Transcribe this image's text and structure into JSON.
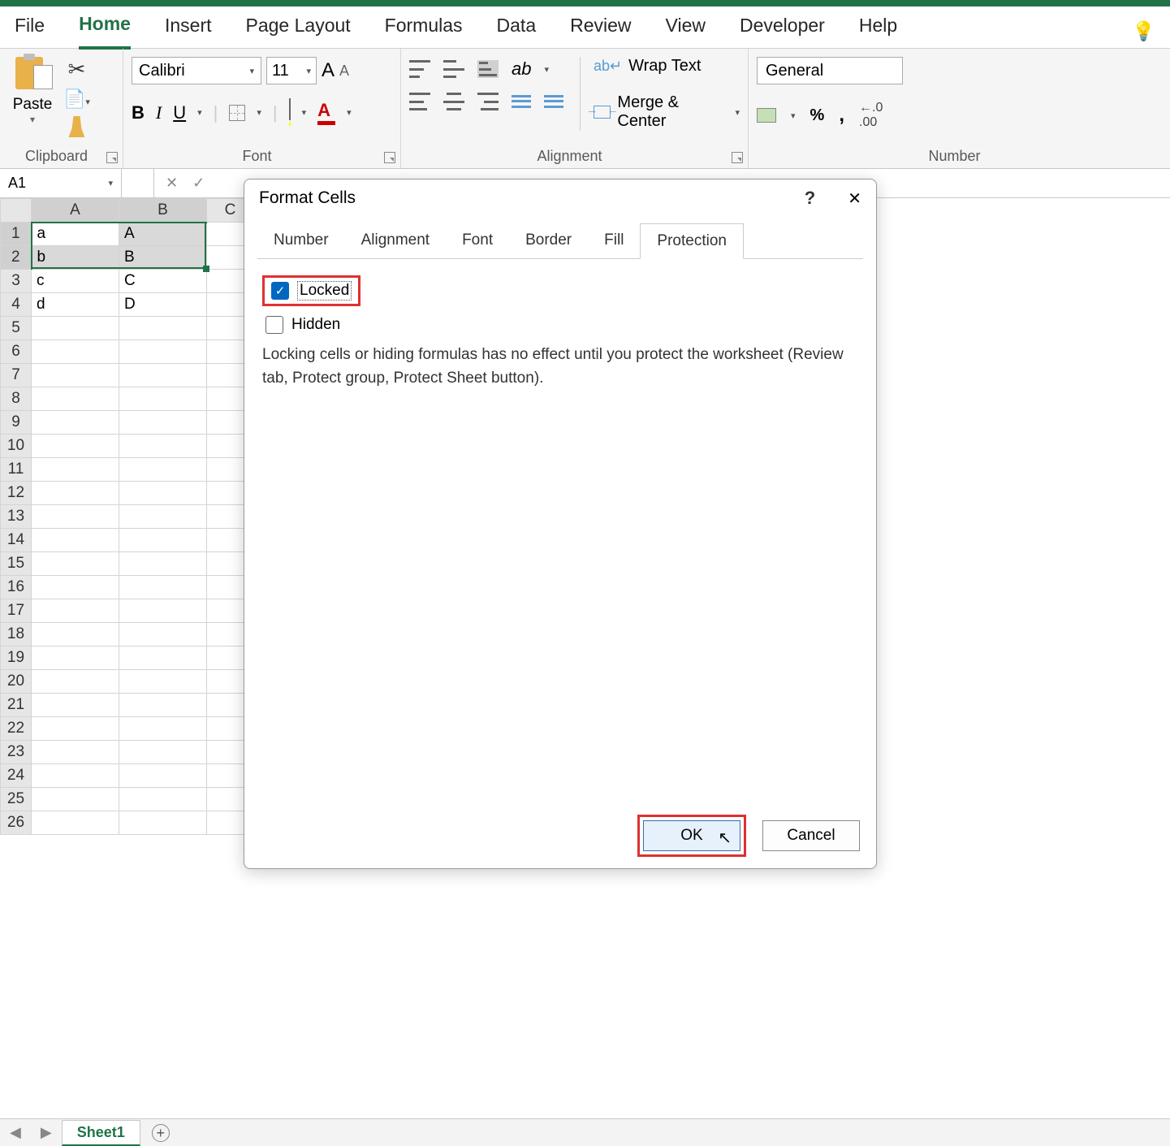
{
  "ribbon": {
    "tabs": [
      "File",
      "Home",
      "Insert",
      "Page Layout",
      "Formulas",
      "Data",
      "Review",
      "View",
      "Developer",
      "Help"
    ],
    "activeTab": "Home",
    "clipboard": {
      "label": "Clipboard",
      "paste": "Paste"
    },
    "font": {
      "label": "Font",
      "name": "Calibri",
      "size": "11"
    },
    "alignment": {
      "label": "Alignment",
      "wrap": "Wrap Text",
      "merge": "Merge & Center"
    },
    "number": {
      "label": "Number",
      "format": "General"
    }
  },
  "namebox": "A1",
  "columns": [
    "A",
    "B",
    "C"
  ],
  "rows": [
    {
      "n": "1",
      "A": "a",
      "B": "A"
    },
    {
      "n": "2",
      "A": "b",
      "B": "B"
    },
    {
      "n": "3",
      "A": "c",
      "B": "C"
    },
    {
      "n": "4",
      "A": "d",
      "B": "D"
    },
    {
      "n": "5"
    },
    {
      "n": "6"
    },
    {
      "n": "7"
    },
    {
      "n": "8"
    },
    {
      "n": "9"
    },
    {
      "n": "10"
    },
    {
      "n": "11"
    },
    {
      "n": "12"
    },
    {
      "n": "13"
    },
    {
      "n": "14"
    },
    {
      "n": "15"
    },
    {
      "n": "16"
    },
    {
      "n": "17"
    },
    {
      "n": "18"
    },
    {
      "n": "19"
    },
    {
      "n": "20"
    },
    {
      "n": "21"
    },
    {
      "n": "22"
    },
    {
      "n": "23"
    },
    {
      "n": "24"
    },
    {
      "n": "25"
    },
    {
      "n": "26"
    }
  ],
  "sheetTab": "Sheet1",
  "dialog": {
    "title": "Format Cells",
    "tabs": [
      "Number",
      "Alignment",
      "Font",
      "Border",
      "Fill",
      "Protection"
    ],
    "activeTab": "Protection",
    "locked": {
      "label": "Locked",
      "checked": true
    },
    "hidden": {
      "label": "Hidden",
      "checked": false
    },
    "info": "Locking cells or hiding formulas has no effect until you protect the worksheet (Review tab, Protect group, Protect Sheet button).",
    "ok": "OK",
    "cancel": "Cancel"
  }
}
